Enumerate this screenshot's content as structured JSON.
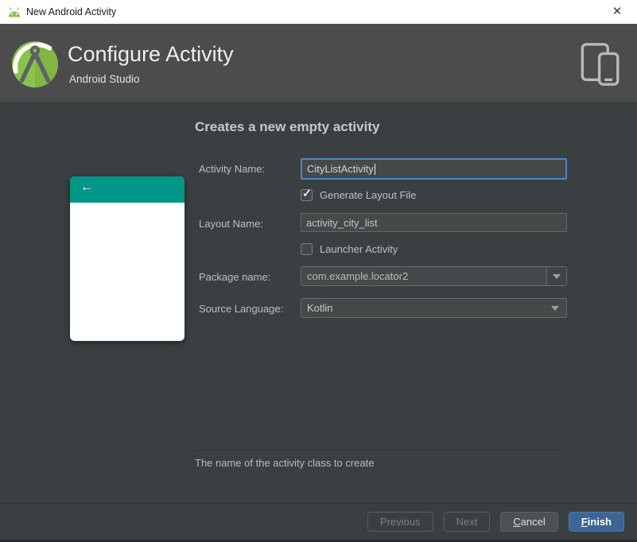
{
  "window": {
    "title": "New Android Activity"
  },
  "icons": {
    "close": "✕",
    "back_arrow": "←",
    "checkmark": "✓",
    "dropdown_arrow": "▼"
  },
  "header": {
    "title": "Configure Activity",
    "subtitle": "Android Studio"
  },
  "content": {
    "heading": "Creates a new empty activity",
    "fields": {
      "activity_name": {
        "label": "Activity Name:",
        "value": "CityListActivity"
      },
      "generate_layout_file": {
        "label": "Generate Layout File",
        "checked": true
      },
      "layout_name": {
        "label": "Layout Name:",
        "value": "activity_city_list"
      },
      "launcher_activity": {
        "label": "Launcher Activity",
        "checked": false
      },
      "package_name": {
        "label": "Package name:",
        "value": "com.example.locator2"
      },
      "source_language": {
        "label": "Source Language:",
        "value": "Kotlin"
      }
    },
    "hint": "The name of the activity class to create"
  },
  "buttons": {
    "previous": "Previous",
    "next": "Next",
    "cancel": {
      "mnemonic": "C",
      "rest": "ancel"
    },
    "finish": {
      "mnemonic": "F",
      "rest": "inish"
    }
  },
  "colors": {
    "accent_teal": "#009688",
    "focus_blue": "#4a88c7",
    "finish_blue": "#3c6595",
    "android_green": "#8bc34a",
    "header_gray": "#4c4c4c",
    "panel_gray": "#3a3f42"
  }
}
